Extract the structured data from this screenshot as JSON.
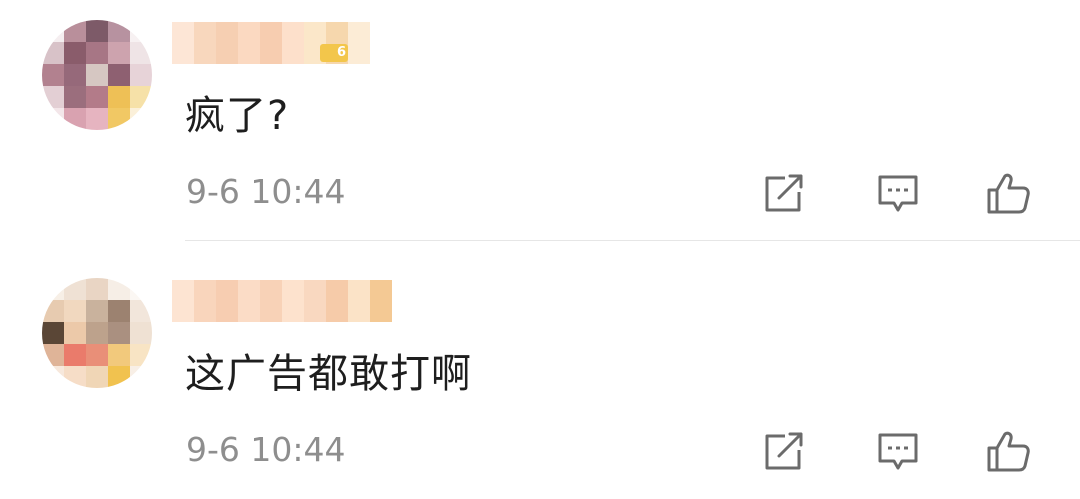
{
  "comments": [
    {
      "text": "疯了?",
      "time": "9-6 10:44",
      "level": "6",
      "avatar_pixels": [
        [
          "#f5eef0",
          "#b98f9b",
          "#7d5a68",
          "#b792a0",
          "#f7f1f2"
        ],
        [
          "#d8c2c8",
          "#8a5c6b",
          "#a77685",
          "#cda3ae",
          "#efe4e6"
        ],
        [
          "#b2818f",
          "#96697a",
          "#d6c7c2",
          "#8e6071",
          "#e7d3d8"
        ],
        [
          "#e3cfd4",
          "#9b6e7d",
          "#b37b89",
          "#eec056",
          "#f6e1a8"
        ],
        [
          "#f3e6e9",
          "#d9a2b0",
          "#e6b4c0",
          "#f1c864",
          "#fbf0d9"
        ]
      ],
      "name_pixels": [
        "#fde6d6",
        "#f8d7bd",
        "#f6cfb2",
        "#fbd9c1",
        "#f7cdb0",
        "#fde0cb",
        "#fbe7c9",
        "#f6d7ad",
        "#fcecd6"
      ]
    },
    {
      "text": "这广告都敢打啊",
      "time": "9-6 10:44",
      "avatar_pixels": [
        [
          "#f7efe6",
          "#efe1d4",
          "#e9d5c4",
          "#f6eee6",
          "#fbf7f3"
        ],
        [
          "#e7cbb0",
          "#f1d8bf",
          "#c9b29d",
          "#9c8270",
          "#f2e6db"
        ],
        [
          "#5a4636",
          "#ecc9a9",
          "#bda28c",
          "#aa9080",
          "#efe1d3"
        ],
        [
          "#dfb498",
          "#ea7b6b",
          "#e98f78",
          "#f2c97c",
          "#f8e4c4"
        ],
        [
          "#f7e8dc",
          "#f6ddc7",
          "#f0d6b6",
          "#f1c24f",
          "#f8efe6"
        ]
      ],
      "name_pixels": [
        "#fde4d2",
        "#f9d5bc",
        "#f7cdb1",
        "#fbdcc6",
        "#f8d2b7",
        "#fde2cd",
        "#f9d8c0",
        "#f6cba9",
        "#fbe3c7",
        "#f4c994"
      ]
    }
  ],
  "actions": {
    "share": "share-icon",
    "reply": "reply-icon",
    "like": "like-icon"
  },
  "colors": {
    "text": "#1e1e1e",
    "time": "#8e8e8e",
    "icon": "#6b6b6b",
    "divider": "#e6e6e6",
    "badge": "#f3c64b"
  }
}
